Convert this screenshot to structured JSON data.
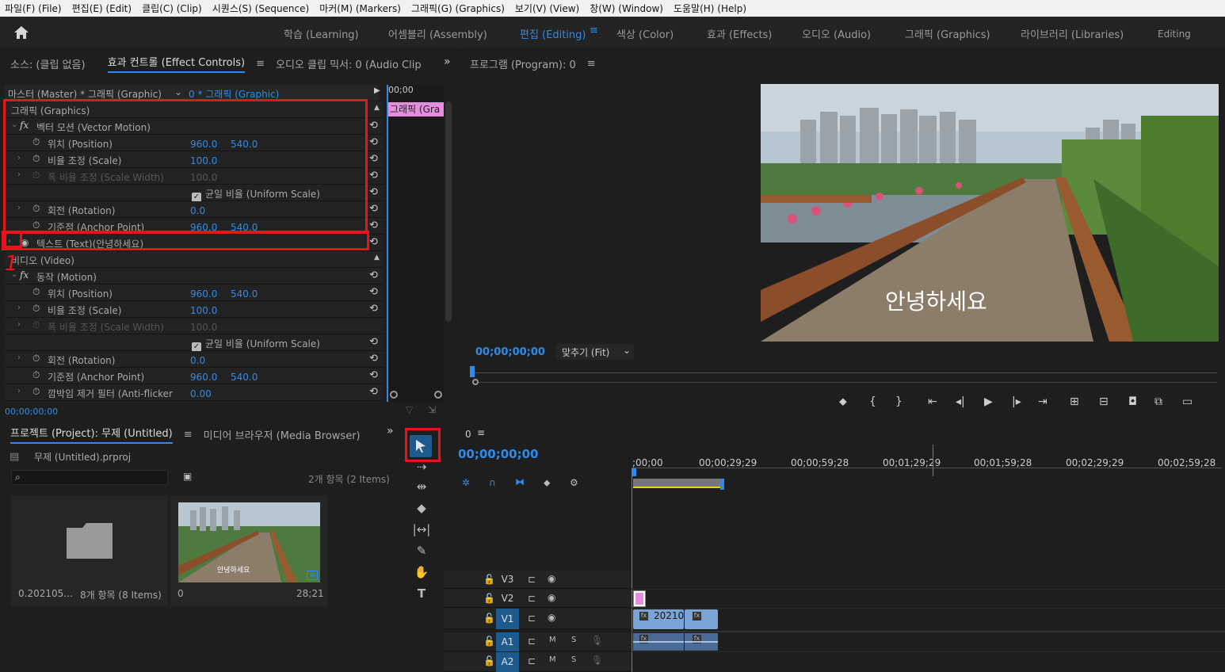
{
  "menu": [
    "파일(F) (File)",
    "편집(E) (Edit)",
    "클립(C) (Clip)",
    "시퀀스(S) (Sequence)",
    "마커(M) (Markers)",
    "그래픽(G) (Graphics)",
    "보기(V) (View)",
    "창(W) (Window)",
    "도움말(H) (Help)"
  ],
  "workspaces": {
    "learning": "학습 (Learning)",
    "assembly": "어셈블리 (Assembly)",
    "editing": "편집 (Editing)",
    "color": "색상 (Color)",
    "effects": "효과 (Effects)",
    "audio": "오디오 (Audio)",
    "graphics": "그래픽 (Graphics)",
    "libraries": "라이브러리 (Libraries)",
    "current": "Editing"
  },
  "source_panel": {
    "tab_source": "소스: (클립 없음)",
    "tab_effect_controls": "효과 컨트롤 (Effect Controls)",
    "tab_audio_mixer": "오디오 클립 믹서: 0 (Audio Clip",
    "master_label": "마스터 (Master) * 그래픽 (Graphic)",
    "clip_label": "0 * 그래픽 (Graphic)",
    "mini_time": "00;00",
    "mini_clip": "그래픽 (Gra",
    "timecode": "00;00;00;00",
    "graphics_section": "그래픽 (Graphics)",
    "vector_motion": "벡터 모션 (Vector Motion)",
    "position": "위치 (Position)",
    "scale": "비율 조정 (Scale)",
    "scale_width": "폭 비율 조정 (Scale Width)",
    "uniform_scale": "균일 비율 (Uniform Scale)",
    "rotation": "회전 (Rotation)",
    "anchor_point": "기준점 (Anchor Point)",
    "text_layer": "텍스트 (Text)(안녕하세요)",
    "video_section": "비디오 (Video)",
    "motion": "동작 (Motion)",
    "anti_flicker": "깜박임 제거 필터 (Anti-flicker",
    "values": {
      "pos_x": "960.0",
      "pos_y": "540.0",
      "scale": "100.0",
      "scale_width": "100.0",
      "rotation": "0.0",
      "anchor_x": "960.0",
      "anchor_y": "540.0",
      "anti_flicker": "0.00"
    }
  },
  "program_panel": {
    "title": "프로그램 (Program): 0",
    "overlay_text": "안녕하세요",
    "timecode": "00;00;00;00",
    "fit": "맞추기 (Fit)"
  },
  "project_panel": {
    "tab_project": "프로젝트 (Project): 무제 (Untitled)",
    "tab_media": "미디어 브라우저 (Media Browser)",
    "file": "무제 (Untitled).prproj",
    "count": "2개 항목 (2 Items)",
    "bin_name": "0.202105...",
    "bin_count": "8개 항목 (8 Items)",
    "seq_name": "0",
    "seq_duration": "28;21",
    "thumb_text": "안녕하세요"
  },
  "timeline": {
    "seq_name": "0",
    "timecode": "00;00;00;00",
    "ruler": [
      ";00;00",
      "00;00;29;29",
      "00;00;59;28",
      "00;01;29;29",
      "00;01;59;28",
      "00;02;29;29",
      "00;02;59;28"
    ],
    "tracks": {
      "v3": "V3",
      "v2": "V2",
      "v1": "V1",
      "a1": "A1",
      "a2": "A2"
    },
    "clip_label": "20210",
    "m": "M",
    "s": "S"
  },
  "annotations": {
    "marker1": "1",
    "marker2": "1"
  },
  "colors": {
    "accent": "#2d8ceb",
    "highlight_box": "#e8141b",
    "graphic_clip": "#e58ee0",
    "video_clip": "#7aa4d6"
  }
}
